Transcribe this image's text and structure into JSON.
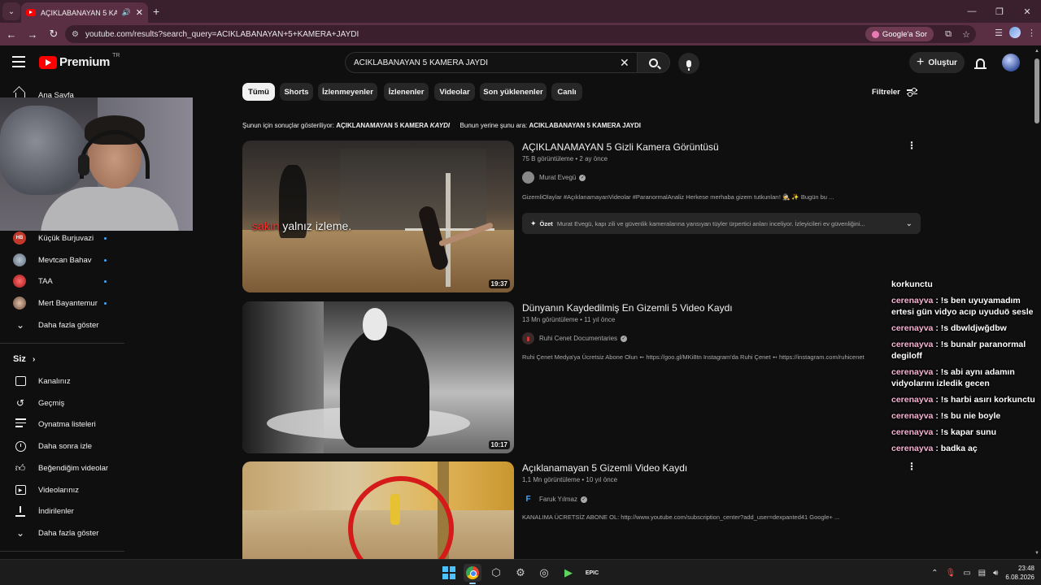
{
  "browser": {
    "tab_title": "AÇIKLABANAYAN 5 KAMER",
    "url": "youtube.com/results?search_query=ACIKLABANAYAN+5+KAMERA+JAYDI",
    "google_ask_label": "Google'a Sor"
  },
  "youtube": {
    "logo_text": "Premium",
    "region": "TR",
    "search_value": "ACIKLABANAYAN 5 KAMERA JAYDI",
    "create_label": "Oluştur"
  },
  "sidebar": {
    "home_label": "Ana Sayfa",
    "channels": [
      {
        "name": "Küçük Burjuvazi",
        "initials": "HB",
        "color": "#c0392b"
      },
      {
        "name": "Mevtcan Bahav",
        "initials": "",
        "color": "#7a8a9a"
      },
      {
        "name": "TAA",
        "initials": "",
        "color": "#c0392b"
      },
      {
        "name": "Mert Bayantemur",
        "initials": "",
        "color": "#8a6a5a"
      }
    ],
    "show_more_channels": "Daha fazla göster",
    "you_header": "Siz",
    "you_items": [
      {
        "label": "Kanalınız",
        "icon": "channel-icon"
      },
      {
        "label": "Geçmiş",
        "icon": "history-icon"
      },
      {
        "label": "Oynatma listeleri",
        "icon": "playlists-icon"
      },
      {
        "label": "Daha sonra izle",
        "icon": "watch-later-icon"
      },
      {
        "label": "Beğendiğim videolar",
        "icon": "thumbs-up-icon"
      },
      {
        "label": "Videolarınız",
        "icon": "your-videos-icon"
      },
      {
        "label": "İndirilenler",
        "icon": "download-icon"
      },
      {
        "label": "Daha fazla göster",
        "icon": "chevron-down-icon"
      }
    ]
  },
  "chips": [
    "Tümü",
    "Shorts",
    "İzlenmeyenler",
    "İzlenenler",
    "Videolar",
    "Son yüklenenler",
    "Canlı"
  ],
  "filters_label": "Filtreler",
  "correction": {
    "showing_prefix": "Şunun için sonuçlar gösteriliyor:",
    "corrected_query_a": "AÇIKLANAMAYAN 5 KAMERA",
    "corrected_query_b": "KAYDI",
    "instead_prefix": "Bunun yerine şunu ara:",
    "original_query": "ACIKLABANAYAN 5 KAMERA JAYDI"
  },
  "results": [
    {
      "title": "AÇIKLANAMAYAN 5 Gizli Kamera Görüntüsü",
      "meta": "75 B görüntüleme • 2 ay önce",
      "channel": "Murat Evegü",
      "description": "GizemliOlaylar #AçıklanamayanVideolar #ParanormalAnaliz Herkese merhaba gizem tutkunları! 🕵️ ✨ Bugün bu ...",
      "duration": "19:37",
      "thumb_caption_red": "sakın",
      "thumb_caption": "yalnız izleme.",
      "summary_label": "Özet",
      "summary_text": "Murat Evegü, kapı zili ve güvenlik kameralarına yansıyan tüyler ürpertici anları inceliyor. İzleyicileri ev güvenliğini..."
    },
    {
      "title": "Dünyanın Kaydedilmiş En Gizemli 5 Video Kaydı",
      "meta": "13 Mn görüntüleme • 11 yıl önce",
      "channel": "Ruhi Cenet Documentaries",
      "description": "Ruhi Çenet Medya'ya Ücretsiz Abone Olun ➻ https://goo.gl/MKi8tn Instagram'da Ruhi Çenet ➻ https://instagram.com/ruhicenet",
      "duration": "10:17"
    },
    {
      "title": "Açıklanamayan 5 Gizemli Video Kaydı",
      "meta": "1,1 Mn görüntüleme • 10 yıl önce",
      "channel": "Faruk Yılmaz",
      "description": "KANALIMA ÜCRETSİZ ABONE OL: http://www.youtube.com/subscription_center?add_user=dexpanted41 Google+ ..."
    }
  ],
  "chat": {
    "header": "korkunctu",
    "messages": [
      {
        "user": "cerenayva",
        "text": ": !s ben uyuyamadım ertesi gün vidyo acıp uyuduö sesle"
      },
      {
        "user": "cerenayva",
        "text": ": !s dbwldjwğdbw"
      },
      {
        "user": "cerenayva",
        "text": ": !s bunalr paranormal degiloff"
      },
      {
        "user": "cerenayva",
        "text": ": !s abi aynı adamın vidyolarını izledik gecen"
      },
      {
        "user": "cerenayva",
        "text": ": !s harbi asırı korkunctu"
      },
      {
        "user": "cerenayva",
        "text": ": !s bu nie boyle"
      },
      {
        "user": "cerenayva",
        "text": ": !s kapar sunu"
      },
      {
        "user": "cerenayva",
        "text": ": badka aç"
      }
    ]
  },
  "taskbar": {
    "time": "23:48",
    "date": "6.08.2026"
  }
}
